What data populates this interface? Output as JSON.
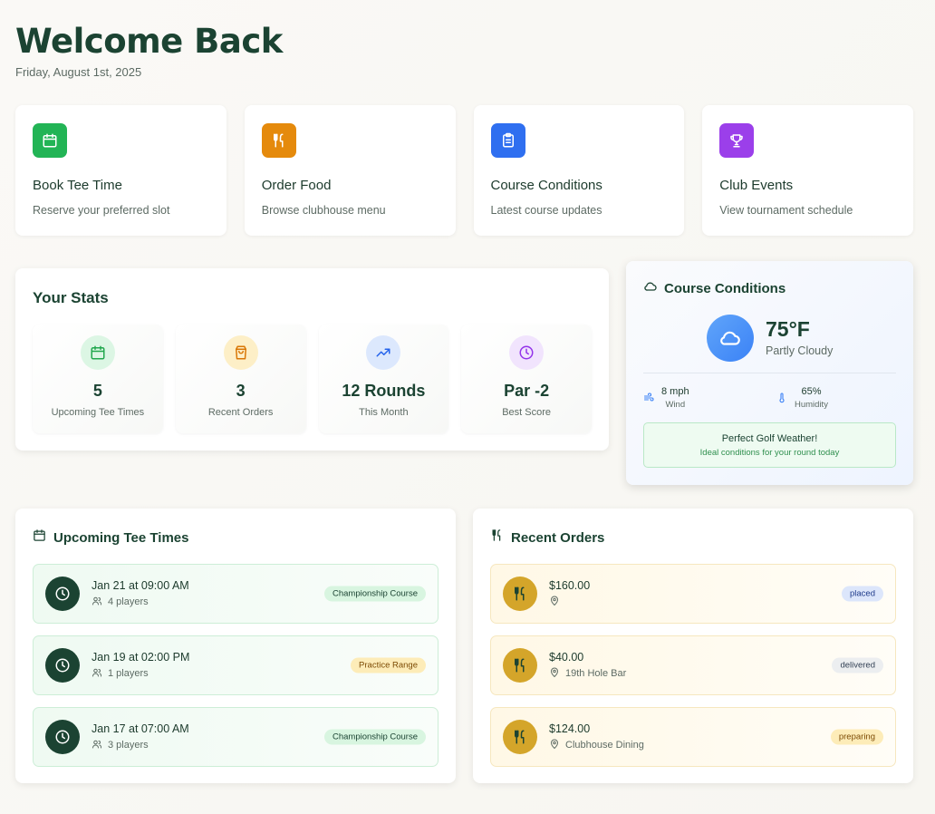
{
  "header": {
    "title": "Welcome Back",
    "date": "Friday, August 1st, 2025"
  },
  "quick_actions": [
    {
      "title": "Book Tee Time",
      "desc": "Reserve your preferred slot",
      "icon": "calendar-icon",
      "color": "#22b455"
    },
    {
      "title": "Order Food",
      "desc": "Browse clubhouse menu",
      "icon": "utensils-icon",
      "color": "#e58a0c"
    },
    {
      "title": "Course Conditions",
      "desc": "Latest course updates",
      "icon": "clipboard-icon",
      "color": "#2f6ff0"
    },
    {
      "title": "Club Events",
      "desc": "View tournament schedule",
      "icon": "trophy-icon",
      "color": "#9b3fea"
    }
  ],
  "stats": {
    "heading": "Your Stats",
    "items": [
      {
        "value": "5",
        "label": "Upcoming Tee Times",
        "icon": "calendar-icon"
      },
      {
        "value": "3",
        "label": "Recent Orders",
        "icon": "shopping-bag-icon"
      },
      {
        "value": "12 Rounds",
        "label": "This Month",
        "icon": "trending-up-icon"
      },
      {
        "value": "Par -2",
        "label": "Best Score",
        "icon": "clock-icon"
      }
    ]
  },
  "conditions": {
    "heading": "Course Conditions",
    "temperature": "75°F",
    "sky": "Partly Cloudy",
    "wind_value": "8 mph",
    "wind_label": "Wind",
    "humidity_value": "65%",
    "humidity_label": "Humidity",
    "banner_title": "Perfect Golf Weather!",
    "banner_sub": "Ideal conditions for your round today"
  },
  "tee_times": {
    "heading": "Upcoming Tee Times",
    "items": [
      {
        "when": "Jan 21 at 09:00 AM",
        "players": "4 players",
        "course": "Championship Course",
        "badge": "green"
      },
      {
        "when": "Jan 19 at 02:00 PM",
        "players": "1 players",
        "course": "Practice Range",
        "badge": "yellow"
      },
      {
        "when": "Jan 17 at 07:00 AM",
        "players": "3 players",
        "course": "Championship Course",
        "badge": "green"
      }
    ]
  },
  "orders": {
    "heading": "Recent Orders",
    "items": [
      {
        "amount": "$160.00",
        "location": "",
        "status": "placed",
        "badge": "blue"
      },
      {
        "amount": "$40.00",
        "location": "19th Hole Bar",
        "status": "delivered",
        "badge": "gray"
      },
      {
        "amount": "$124.00",
        "location": "Clubhouse Dining",
        "status": "preparing",
        "badge": "yellow"
      }
    ]
  }
}
